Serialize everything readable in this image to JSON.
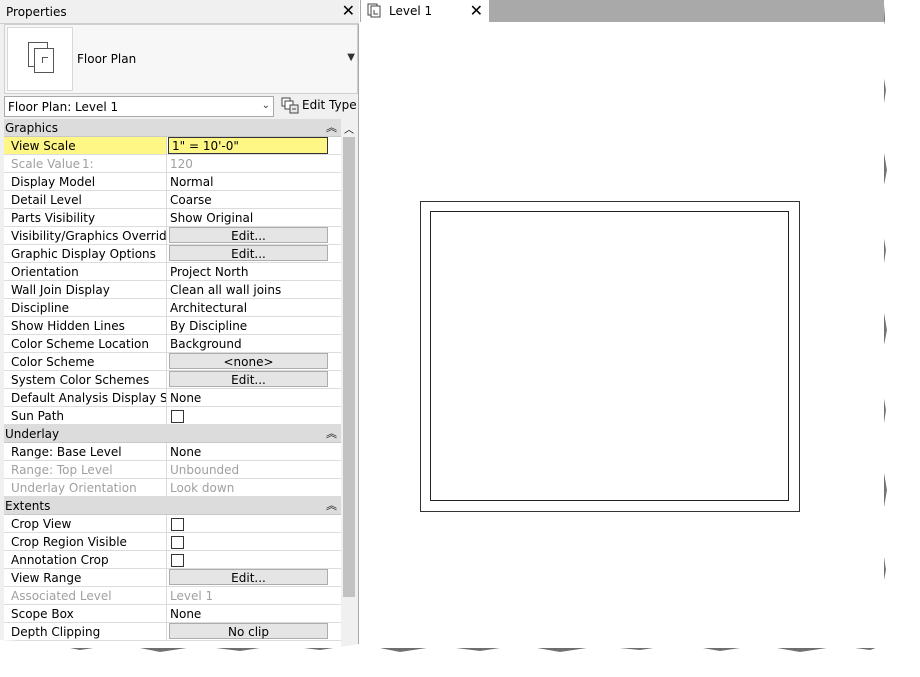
{
  "properties_panel": {
    "title": "Properties",
    "type_selector": {
      "name": "Floor Plan",
      "icon": "floor-plan-icon"
    },
    "instance_filter": "Floor Plan: Level 1",
    "edit_type_label": "Edit Type",
    "sections": {
      "graphics": "Graphics",
      "underlay": "Underlay",
      "extents": "Extents"
    },
    "graphics_rows": [
      {
        "name": "View Scale",
        "value": "1\" = 10'-0\""
      },
      {
        "name": "Scale Value",
        "unit": "1:",
        "value": "120"
      },
      {
        "name": "Display Model",
        "value": "Normal"
      },
      {
        "name": "Detail Level",
        "value": "Coarse"
      },
      {
        "name": "Parts Visibility",
        "value": "Show Original"
      },
      {
        "name": "Visibility/Graphics Overrides",
        "value": "Edit..."
      },
      {
        "name": "Graphic Display Options",
        "value": "Edit..."
      },
      {
        "name": "Orientation",
        "value": "Project North"
      },
      {
        "name": "Wall Join Display",
        "value": "Clean all wall joins"
      },
      {
        "name": "Discipline",
        "value": "Architectural"
      },
      {
        "name": "Show Hidden Lines",
        "value": "By Discipline"
      },
      {
        "name": "Color Scheme Location",
        "value": "Background"
      },
      {
        "name": "Color Scheme",
        "value": "<none>"
      },
      {
        "name": "System Color Schemes",
        "value": "Edit..."
      },
      {
        "name": "Default Analysis Display Style",
        "value": "None"
      },
      {
        "name": "Sun Path",
        "checked": false
      }
    ],
    "underlay_rows": [
      {
        "name": "Range: Base Level",
        "value": "None"
      },
      {
        "name": "Range: Top Level",
        "value": "Unbounded"
      },
      {
        "name": "Underlay Orientation",
        "value": "Look down"
      }
    ],
    "extents_rows": [
      {
        "name": "Crop View",
        "checked": false
      },
      {
        "name": "Crop Region Visible",
        "checked": false
      },
      {
        "name": "Annotation Crop",
        "checked": false
      },
      {
        "name": "View Range",
        "value": "Edit..."
      },
      {
        "name": "Associated Level",
        "value": "Level 1"
      },
      {
        "name": "Scope Box",
        "value": "None"
      },
      {
        "name": "Depth Clipping",
        "value": "No clip"
      }
    ]
  },
  "view_tab": {
    "label": "Level 1",
    "icon": "floor-plan-view-icon"
  },
  "colors": {
    "selected_row": "#fff785",
    "section_header": "#dcdcdc",
    "panel_bg": "#f0f0f0",
    "tab_strip": "#a9a9a9"
  }
}
